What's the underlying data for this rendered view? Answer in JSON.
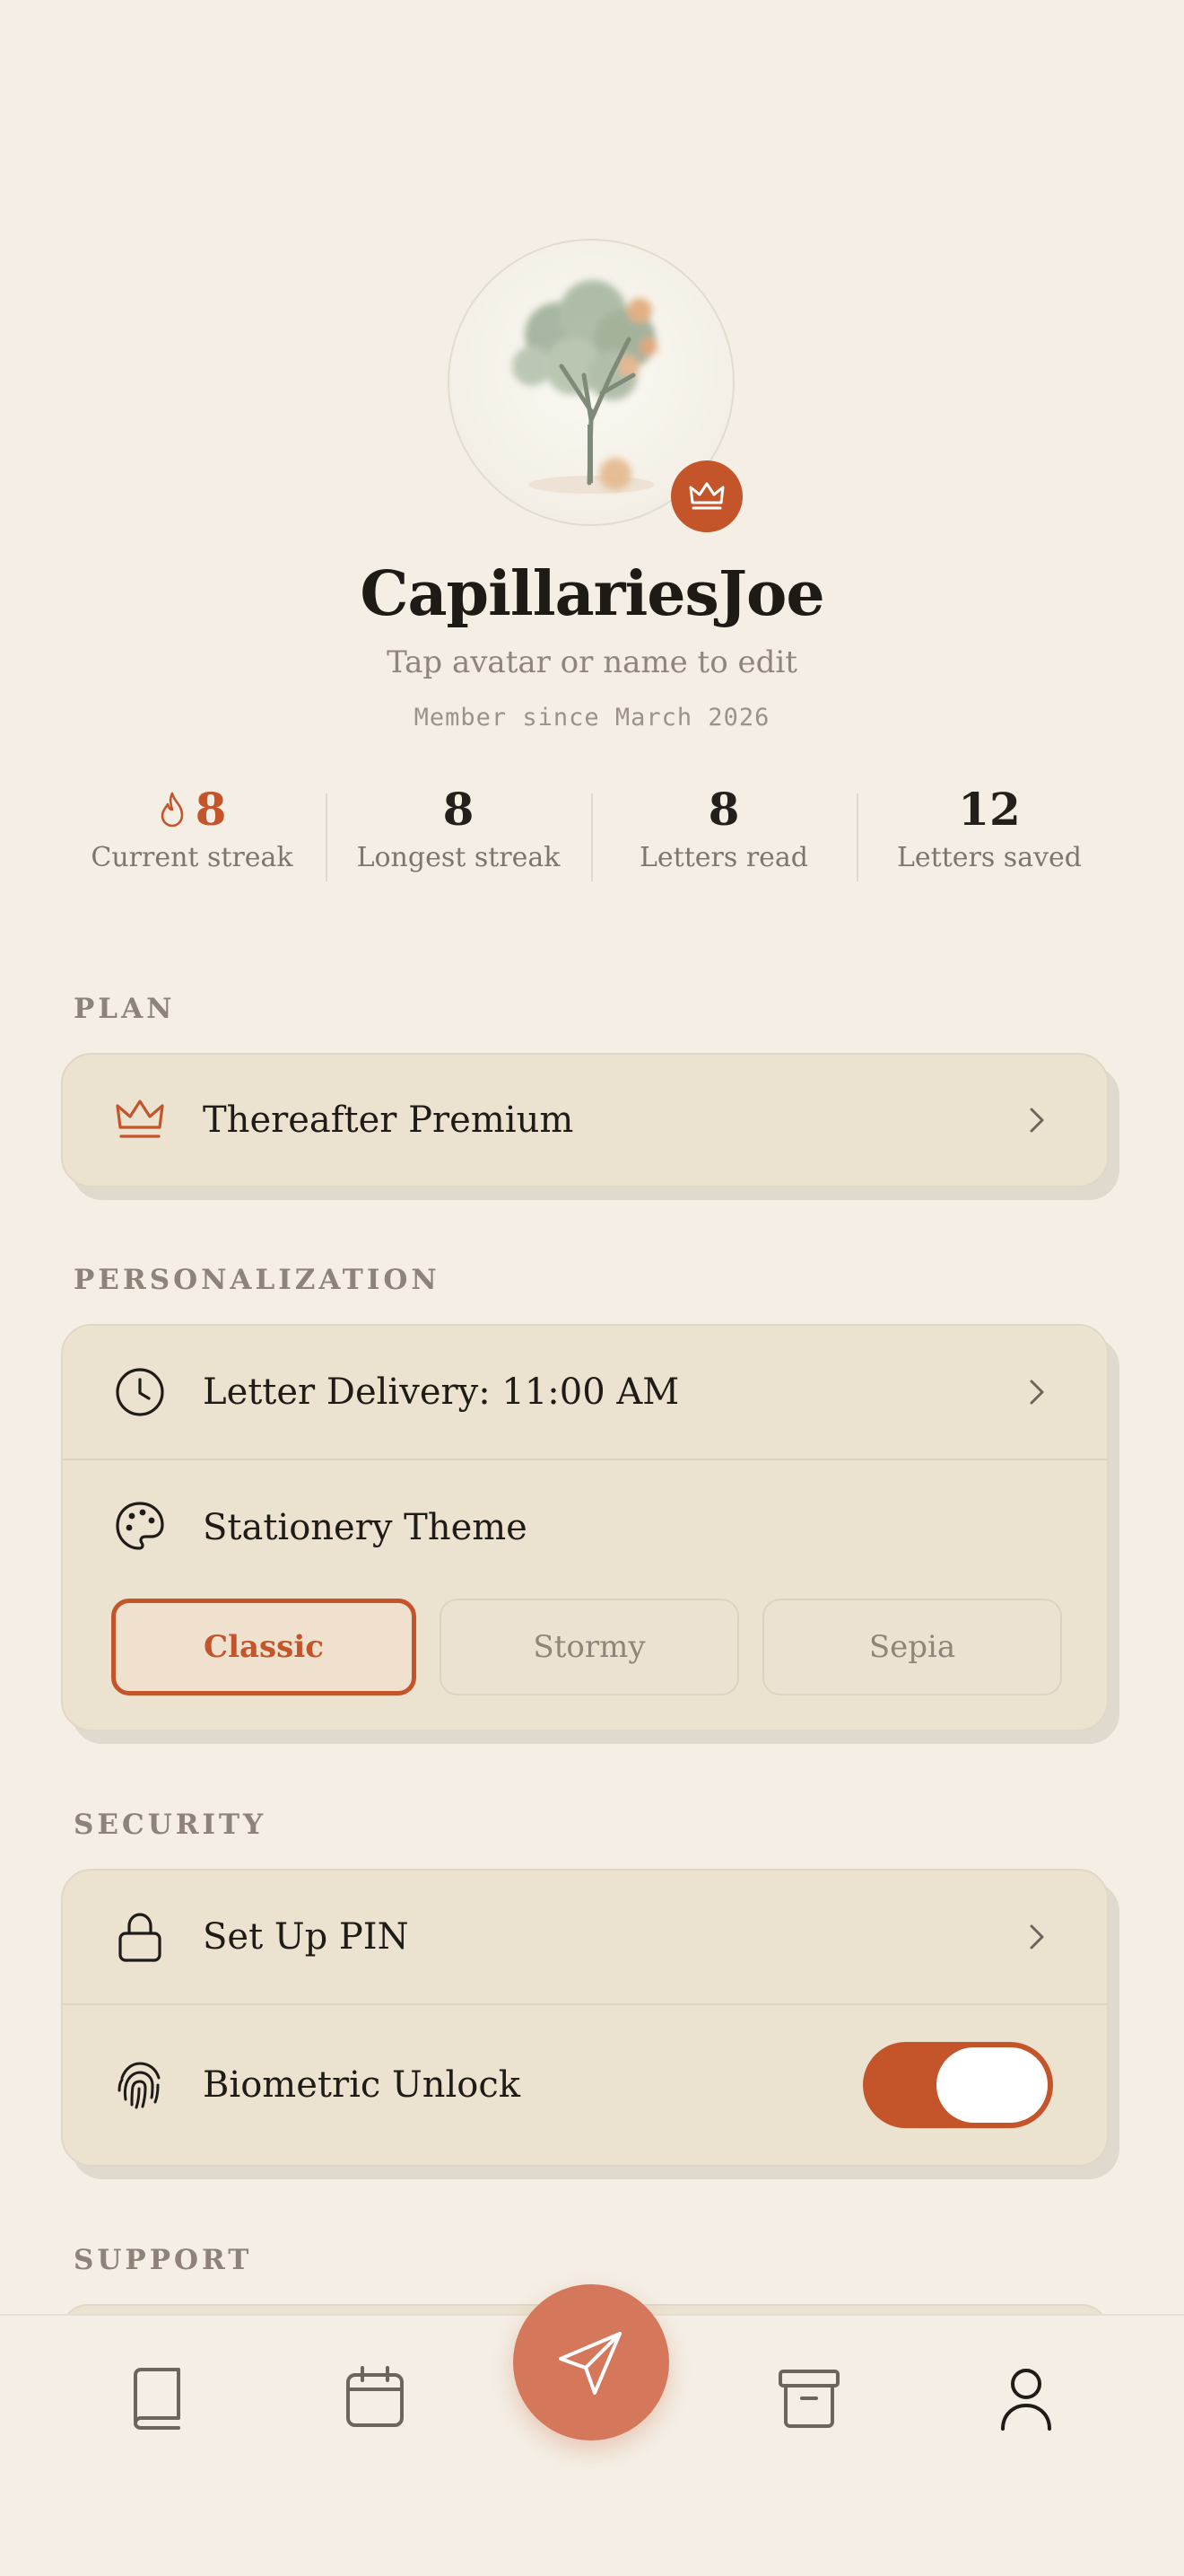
{
  "profile": {
    "username": "CapillariesJoe",
    "edit_hint": "Tap avatar or name to edit",
    "member_since": "Member since March 2026",
    "avatar_icon": "watercolor-tree-avatar",
    "badge_icon": "crown-icon"
  },
  "stats": [
    {
      "value": "8",
      "label": "Current streak",
      "icon": "flame-icon",
      "accent": "#c4552b"
    },
    {
      "value": "8",
      "label": "Longest streak"
    },
    {
      "value": "8",
      "label": "Letters read"
    },
    {
      "value": "12",
      "label": "Letters saved"
    }
  ],
  "sections": {
    "plan": {
      "title": "PLAN",
      "items": [
        {
          "label": "Thereafter Premium",
          "icon": "crown-icon"
        }
      ]
    },
    "personalization": {
      "title": "PERSONALIZATION",
      "delivery_label": "Letter Delivery: 11:00 AM",
      "delivery_icon": "clock-icon",
      "theme_label": "Stationery Theme",
      "theme_icon": "palette-icon",
      "themes": [
        "Classic",
        "Stormy",
        "Sepia"
      ],
      "selected_theme": "Classic"
    },
    "security": {
      "title": "SECURITY",
      "pin_label": "Set Up PIN",
      "pin_icon": "lock-icon",
      "biometric_label": "Biometric Unlock",
      "biometric_icon": "fingerprint-icon",
      "biometric_enabled": true
    },
    "support": {
      "title": "SUPPORT"
    }
  },
  "nav": {
    "items": [
      "book-icon",
      "calendar-icon",
      "send-icon",
      "archive-icon",
      "profile-icon"
    ],
    "active": "profile-icon"
  },
  "colors": {
    "accent": "#c4552b",
    "background": "#f4eee4",
    "card": "#ebe3d0"
  }
}
